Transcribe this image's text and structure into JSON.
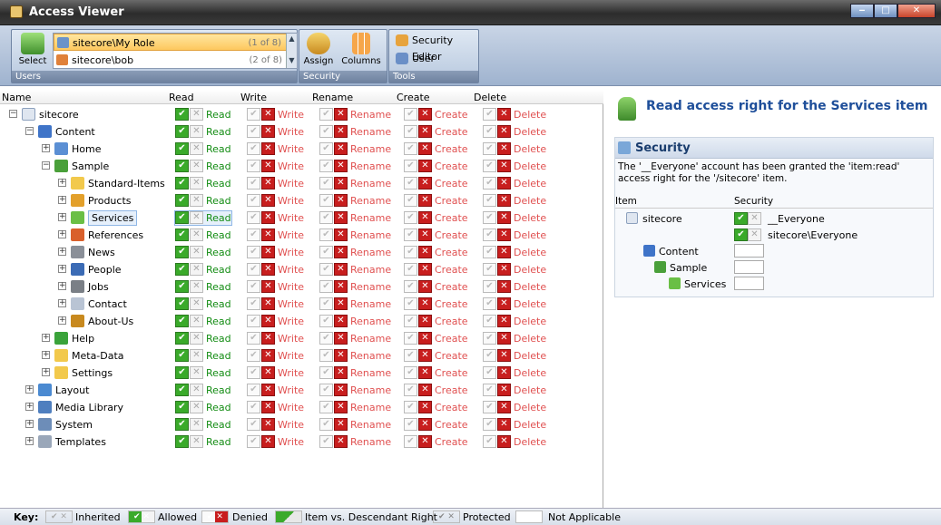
{
  "window": {
    "title": "Access Viewer",
    "minimize": "‒",
    "maximize": "□",
    "close": "✕"
  },
  "ribbon": {
    "users_group": {
      "label": "Users",
      "select_label": "Select",
      "users": [
        {
          "name": "sitecore\\My Role",
          "count": "(1 of 8)",
          "selected": true
        },
        {
          "name": "sitecore\\bob",
          "count": "(2 of 8)",
          "selected": false
        }
      ]
    },
    "security_group": {
      "label": "Security",
      "assign_label": "Assign",
      "columns_label": "Columns"
    },
    "tools_group": {
      "label": "Tools",
      "security_editor": "Security Editor",
      "user_manager": "User Manager"
    }
  },
  "grid": {
    "columns": [
      "Name",
      "Read",
      "Write",
      "Rename",
      "Create",
      "Delete"
    ],
    "rights_labels": {
      "read": "Read",
      "write": "Write",
      "rename": "Rename",
      "create": "Create",
      "delete": "Delete"
    },
    "rows": [
      {
        "name": "sitecore",
        "depth": 0,
        "expanded": true,
        "icon": "document-icon"
      },
      {
        "name": "Content",
        "depth": 1,
        "expanded": true,
        "icon": "content-icon"
      },
      {
        "name": "Home",
        "depth": 2,
        "expanded": false,
        "icon": "home-icon"
      },
      {
        "name": "Sample",
        "depth": 2,
        "expanded": true,
        "icon": "sample-icon"
      },
      {
        "name": "Standard-Items",
        "depth": 3,
        "expanded": false,
        "icon": "folder-icon"
      },
      {
        "name": "Products",
        "depth": 3,
        "expanded": false,
        "icon": "products-icon"
      },
      {
        "name": "Services",
        "depth": 3,
        "expanded": false,
        "icon": "services-icon",
        "selected": true
      },
      {
        "name": "References",
        "depth": 3,
        "expanded": false,
        "icon": "references-icon"
      },
      {
        "name": "News",
        "depth": 3,
        "expanded": false,
        "icon": "news-icon"
      },
      {
        "name": "People",
        "depth": 3,
        "expanded": false,
        "icon": "people-icon"
      },
      {
        "name": "Jobs",
        "depth": 3,
        "expanded": false,
        "icon": "jobs-icon"
      },
      {
        "name": "Contact",
        "depth": 3,
        "expanded": false,
        "icon": "contact-icon"
      },
      {
        "name": "About-Us",
        "depth": 3,
        "expanded": false,
        "icon": "about-icon"
      },
      {
        "name": "Help",
        "depth": 2,
        "expanded": false,
        "icon": "help-icon"
      },
      {
        "name": "Meta-Data",
        "depth": 2,
        "expanded": false,
        "icon": "folder-icon"
      },
      {
        "name": "Settings",
        "depth": 2,
        "expanded": false,
        "icon": "folder-icon"
      },
      {
        "name": "Layout",
        "depth": 1,
        "expanded": false,
        "icon": "layout-icon"
      },
      {
        "name": "Media Library",
        "depth": 1,
        "expanded": false,
        "icon": "media-icon"
      },
      {
        "name": "System",
        "depth": 1,
        "expanded": false,
        "icon": "system-icon"
      },
      {
        "name": "Templates",
        "depth": 1,
        "expanded": false,
        "icon": "templates-icon"
      }
    ]
  },
  "panel": {
    "title": "Read access right for the Services item",
    "section_title": "Security",
    "description": "The '__Everyone' account has been granted the 'item:read' access right for the '/sitecore' item.",
    "table_headers": {
      "item": "Item",
      "security": "Security"
    },
    "entries": [
      {
        "item": "sitecore",
        "accounts": [
          "__Everyone",
          "sitecore\\Everyone"
        ]
      },
      {
        "item": "Content",
        "accounts": []
      },
      {
        "item": "Sample",
        "accounts": []
      },
      {
        "item": "Services",
        "accounts": []
      }
    ]
  },
  "key": {
    "label": "Key:",
    "inherited": "Inherited",
    "allowed": "Allowed",
    "denied": "Denied",
    "descendant": "Item vs. Descendant Right",
    "protected": "Protected",
    "not_applicable": "Not Applicable"
  },
  "colors": {
    "allow": "#3aaa2a",
    "deny": "#c81e1e",
    "title_blue": "#1f4f9a"
  }
}
